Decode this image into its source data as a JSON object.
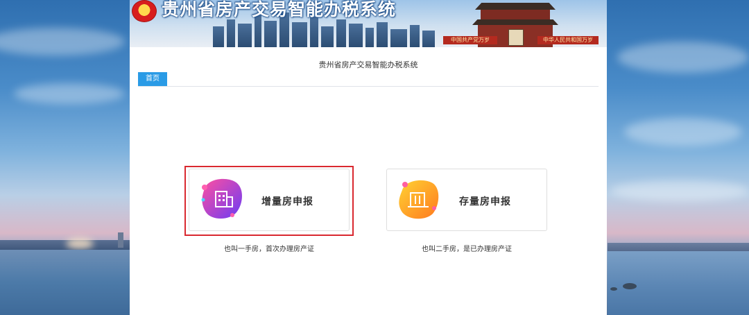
{
  "banner": {
    "title": "贵州省房产交易智能办税系统",
    "slogan_left": "中国共产党万岁",
    "slogan_right": "中华人民共和国万岁"
  },
  "panel": {
    "system_title": "贵州省房产交易智能办税系统",
    "tabs": [
      {
        "label": "首页",
        "active": true
      }
    ]
  },
  "options": [
    {
      "label": "增量房申报",
      "caption": "也叫一手房，首次办理房产证",
      "icon": "building-icon",
      "accent": "#8a3cf0",
      "highlighted": true
    },
    {
      "label": "存量房申报",
      "caption": "也叫二手房，是已办理房产证",
      "icon": "house-icon",
      "accent": "#f7a01f",
      "highlighted": false
    }
  ],
  "colors": {
    "tab_active": "#2a9be6",
    "highlight_border": "#d9282f"
  }
}
